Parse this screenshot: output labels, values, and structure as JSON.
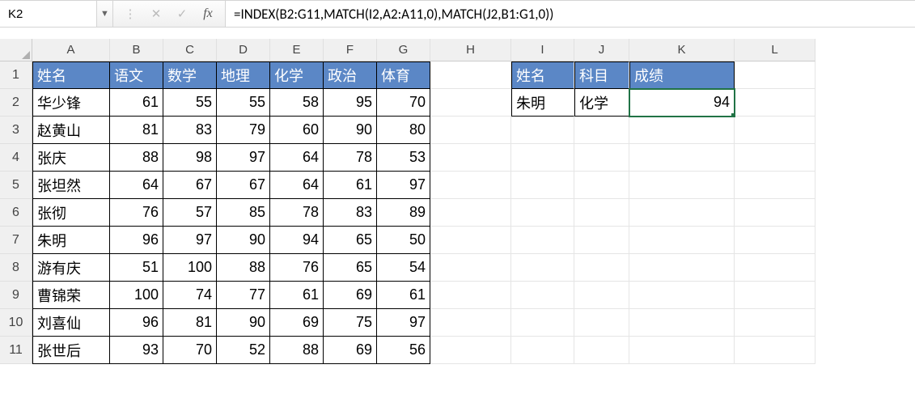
{
  "namebox": "K2",
  "formula": "=INDEX(B2:G11,MATCH(I2,A2:A11,0),MATCH(J2,B1:G1,0))",
  "columns": [
    "A",
    "B",
    "C",
    "D",
    "E",
    "F",
    "G",
    "H",
    "I",
    "J",
    "K",
    "L"
  ],
  "rows": [
    "1",
    "2",
    "3",
    "4",
    "5",
    "6",
    "7",
    "8",
    "9",
    "10",
    "11"
  ],
  "main_table": {
    "headers": [
      "姓名",
      "语文",
      "数学",
      "地理",
      "化学",
      "政治",
      "体育"
    ],
    "data": [
      {
        "name": "华少锋",
        "scores": [
          61,
          55,
          55,
          58,
          95,
          70
        ]
      },
      {
        "name": "赵黄山",
        "scores": [
          81,
          83,
          79,
          60,
          90,
          80
        ]
      },
      {
        "name": "张庆",
        "scores": [
          88,
          98,
          97,
          64,
          78,
          53
        ]
      },
      {
        "name": "张坦然",
        "scores": [
          64,
          67,
          67,
          64,
          61,
          97
        ]
      },
      {
        "name": "张彻",
        "scores": [
          76,
          57,
          85,
          78,
          83,
          89
        ]
      },
      {
        "name": "朱明",
        "scores": [
          96,
          97,
          90,
          94,
          65,
          50
        ]
      },
      {
        "name": "游有庆",
        "scores": [
          51,
          100,
          88,
          76,
          65,
          54
        ]
      },
      {
        "name": "曹锦荣",
        "scores": [
          100,
          74,
          77,
          61,
          69,
          61
        ]
      },
      {
        "name": "刘喜仙",
        "scores": [
          96,
          81,
          90,
          69,
          75,
          97
        ]
      },
      {
        "name": "张世后",
        "scores": [
          93,
          70,
          52,
          88,
          69,
          56
        ]
      }
    ]
  },
  "lookup_table": {
    "headers": [
      "姓名",
      "科目",
      "成绩"
    ],
    "row": {
      "name": "朱明",
      "subject": "化学",
      "result": "94"
    }
  },
  "icons": {
    "dropdown": "▼",
    "cancel": "✕",
    "confirm": "✓",
    "fx": "fx",
    "vdots": "⋮"
  }
}
